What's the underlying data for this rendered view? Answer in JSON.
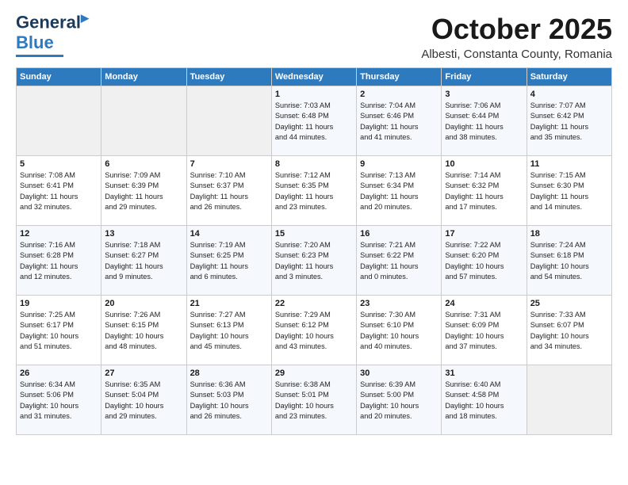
{
  "header": {
    "logo_line1": "General",
    "logo_line2": "Blue",
    "month": "October 2025",
    "location": "Albesti, Constanta County, Romania"
  },
  "weekdays": [
    "Sunday",
    "Monday",
    "Tuesday",
    "Wednesday",
    "Thursday",
    "Friday",
    "Saturday"
  ],
  "weeks": [
    [
      {
        "day": "",
        "info": ""
      },
      {
        "day": "",
        "info": ""
      },
      {
        "day": "",
        "info": ""
      },
      {
        "day": "1",
        "info": "Sunrise: 7:03 AM\nSunset: 6:48 PM\nDaylight: 11 hours\nand 44 minutes."
      },
      {
        "day": "2",
        "info": "Sunrise: 7:04 AM\nSunset: 6:46 PM\nDaylight: 11 hours\nand 41 minutes."
      },
      {
        "day": "3",
        "info": "Sunrise: 7:06 AM\nSunset: 6:44 PM\nDaylight: 11 hours\nand 38 minutes."
      },
      {
        "day": "4",
        "info": "Sunrise: 7:07 AM\nSunset: 6:42 PM\nDaylight: 11 hours\nand 35 minutes."
      }
    ],
    [
      {
        "day": "5",
        "info": "Sunrise: 7:08 AM\nSunset: 6:41 PM\nDaylight: 11 hours\nand 32 minutes."
      },
      {
        "day": "6",
        "info": "Sunrise: 7:09 AM\nSunset: 6:39 PM\nDaylight: 11 hours\nand 29 minutes."
      },
      {
        "day": "7",
        "info": "Sunrise: 7:10 AM\nSunset: 6:37 PM\nDaylight: 11 hours\nand 26 minutes."
      },
      {
        "day": "8",
        "info": "Sunrise: 7:12 AM\nSunset: 6:35 PM\nDaylight: 11 hours\nand 23 minutes."
      },
      {
        "day": "9",
        "info": "Sunrise: 7:13 AM\nSunset: 6:34 PM\nDaylight: 11 hours\nand 20 minutes."
      },
      {
        "day": "10",
        "info": "Sunrise: 7:14 AM\nSunset: 6:32 PM\nDaylight: 11 hours\nand 17 minutes."
      },
      {
        "day": "11",
        "info": "Sunrise: 7:15 AM\nSunset: 6:30 PM\nDaylight: 11 hours\nand 14 minutes."
      }
    ],
    [
      {
        "day": "12",
        "info": "Sunrise: 7:16 AM\nSunset: 6:28 PM\nDaylight: 11 hours\nand 12 minutes."
      },
      {
        "day": "13",
        "info": "Sunrise: 7:18 AM\nSunset: 6:27 PM\nDaylight: 11 hours\nand 9 minutes."
      },
      {
        "day": "14",
        "info": "Sunrise: 7:19 AM\nSunset: 6:25 PM\nDaylight: 11 hours\nand 6 minutes."
      },
      {
        "day": "15",
        "info": "Sunrise: 7:20 AM\nSunset: 6:23 PM\nDaylight: 11 hours\nand 3 minutes."
      },
      {
        "day": "16",
        "info": "Sunrise: 7:21 AM\nSunset: 6:22 PM\nDaylight: 11 hours\nand 0 minutes."
      },
      {
        "day": "17",
        "info": "Sunrise: 7:22 AM\nSunset: 6:20 PM\nDaylight: 10 hours\nand 57 minutes."
      },
      {
        "day": "18",
        "info": "Sunrise: 7:24 AM\nSunset: 6:18 PM\nDaylight: 10 hours\nand 54 minutes."
      }
    ],
    [
      {
        "day": "19",
        "info": "Sunrise: 7:25 AM\nSunset: 6:17 PM\nDaylight: 10 hours\nand 51 minutes."
      },
      {
        "day": "20",
        "info": "Sunrise: 7:26 AM\nSunset: 6:15 PM\nDaylight: 10 hours\nand 48 minutes."
      },
      {
        "day": "21",
        "info": "Sunrise: 7:27 AM\nSunset: 6:13 PM\nDaylight: 10 hours\nand 45 minutes."
      },
      {
        "day": "22",
        "info": "Sunrise: 7:29 AM\nSunset: 6:12 PM\nDaylight: 10 hours\nand 43 minutes."
      },
      {
        "day": "23",
        "info": "Sunrise: 7:30 AM\nSunset: 6:10 PM\nDaylight: 10 hours\nand 40 minutes."
      },
      {
        "day": "24",
        "info": "Sunrise: 7:31 AM\nSunset: 6:09 PM\nDaylight: 10 hours\nand 37 minutes."
      },
      {
        "day": "25",
        "info": "Sunrise: 7:33 AM\nSunset: 6:07 PM\nDaylight: 10 hours\nand 34 minutes."
      }
    ],
    [
      {
        "day": "26",
        "info": "Sunrise: 6:34 AM\nSunset: 5:06 PM\nDaylight: 10 hours\nand 31 minutes."
      },
      {
        "day": "27",
        "info": "Sunrise: 6:35 AM\nSunset: 5:04 PM\nDaylight: 10 hours\nand 29 minutes."
      },
      {
        "day": "28",
        "info": "Sunrise: 6:36 AM\nSunset: 5:03 PM\nDaylight: 10 hours\nand 26 minutes."
      },
      {
        "day": "29",
        "info": "Sunrise: 6:38 AM\nSunset: 5:01 PM\nDaylight: 10 hours\nand 23 minutes."
      },
      {
        "day": "30",
        "info": "Sunrise: 6:39 AM\nSunset: 5:00 PM\nDaylight: 10 hours\nand 20 minutes."
      },
      {
        "day": "31",
        "info": "Sunrise: 6:40 AM\nSunset: 4:58 PM\nDaylight: 10 hours\nand 18 minutes."
      },
      {
        "day": "",
        "info": ""
      }
    ]
  ]
}
